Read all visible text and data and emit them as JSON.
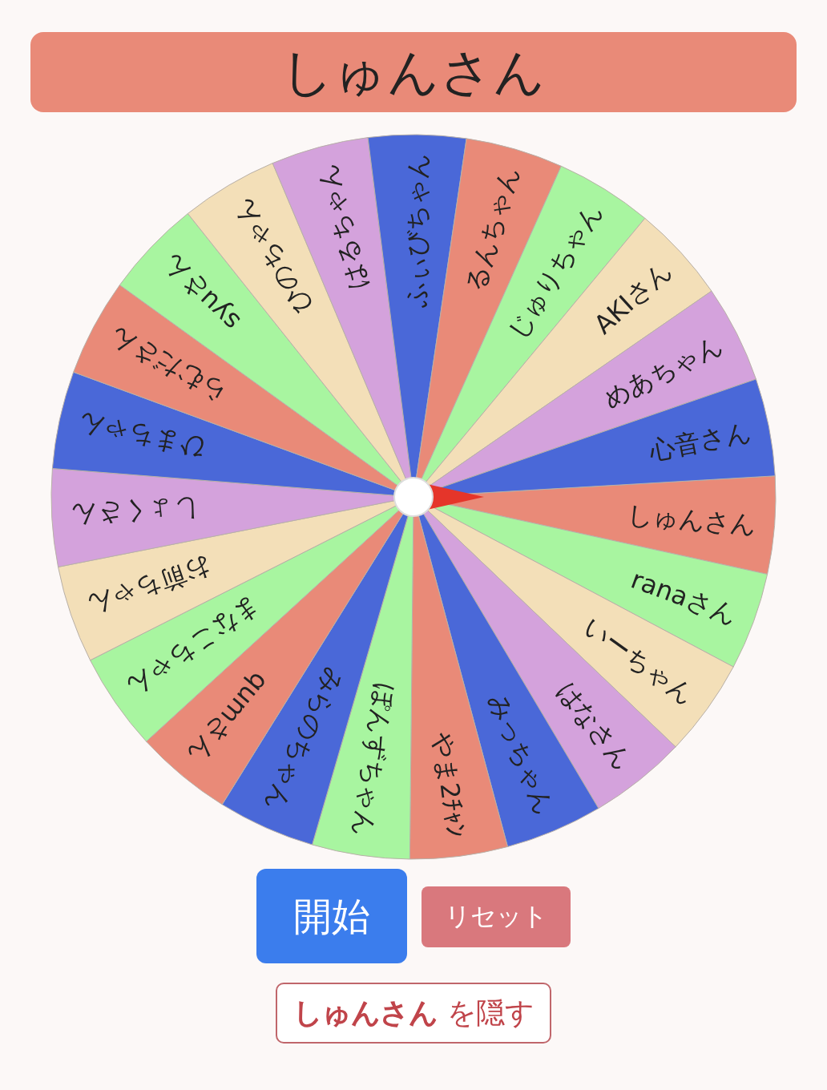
{
  "title": "しゅんさん",
  "wheel": {
    "segments": [
      {
        "label": "しゅんさん",
        "color": "#e98a78"
      },
      {
        "label": "ranaさん",
        "color": "#a8f5a0"
      },
      {
        "label": "いーちゃん",
        "color": "#f3dfb8"
      },
      {
        "label": "はなさん",
        "color": "#d4a2dc"
      },
      {
        "label": "みっちゃん",
        "color": "#4a68d8"
      },
      {
        "label": "やま2ﾁｬﾝ",
        "color": "#e98a78"
      },
      {
        "label": "ぽんずちゃん",
        "color": "#a8f5a0"
      },
      {
        "label": "みらのちゃん",
        "color": "#4a68d8"
      },
      {
        "label": "qumさん",
        "color": "#e98a78"
      },
      {
        "label": "まなこちゃん",
        "color": "#a8f5a0"
      },
      {
        "label": "お前ちゃん",
        "color": "#f3dfb8"
      },
      {
        "label": "しょくさん",
        "color": "#d4a2dc"
      },
      {
        "label": "ひまちゃん",
        "color": "#4a68d8"
      },
      {
        "label": "らむださん",
        "color": "#e98a78"
      },
      {
        "label": "syuさん",
        "color": "#a8f5a0"
      },
      {
        "label": "ひのちゃん",
        "color": "#f3dfb8"
      },
      {
        "label": "はるちゃん",
        "color": "#d4a2dc"
      },
      {
        "label": "ふぃびちゃん",
        "color": "#4a68d8"
      },
      {
        "label": "るんちゃん",
        "color": "#e98a78"
      },
      {
        "label": "じゅりちゃん",
        "color": "#a8f5a0"
      },
      {
        "label": "AKIさん",
        "color": "#f3dfb8"
      },
      {
        "label": "めあちゃん",
        "color": "#d4a2dc"
      },
      {
        "label": "心音さん",
        "color": "#4a68d8"
      }
    ]
  },
  "start_button": "開始",
  "reset_button": "リセット",
  "hide_button": {
    "name": "しゅんさん",
    "suffix": "を隠す"
  }
}
